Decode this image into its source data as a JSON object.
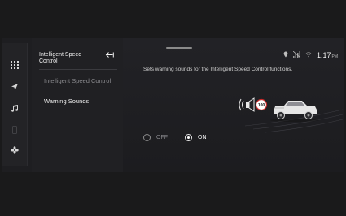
{
  "menu": {
    "title": "Intelligent Speed Control",
    "items": [
      {
        "label": "Intelligent Speed Control",
        "active": false
      },
      {
        "label": "Warning Sounds",
        "active": true
      }
    ]
  },
  "status": {
    "icons": [
      "location-icon",
      "signal-icon",
      "wifi-icon"
    ],
    "time": "1:17",
    "ampm": "PM"
  },
  "content": {
    "description": "Sets warning sounds for the Intelligent Speed Control functions.",
    "speed_sign": "100",
    "options": [
      {
        "label": "OFF",
        "selected": false
      },
      {
        "label": "ON",
        "selected": true
      }
    ]
  },
  "rail": {
    "icons": [
      "apps-icon",
      "navigation-icon",
      "music-icon",
      "phone-icon",
      "fan-icon"
    ]
  }
}
